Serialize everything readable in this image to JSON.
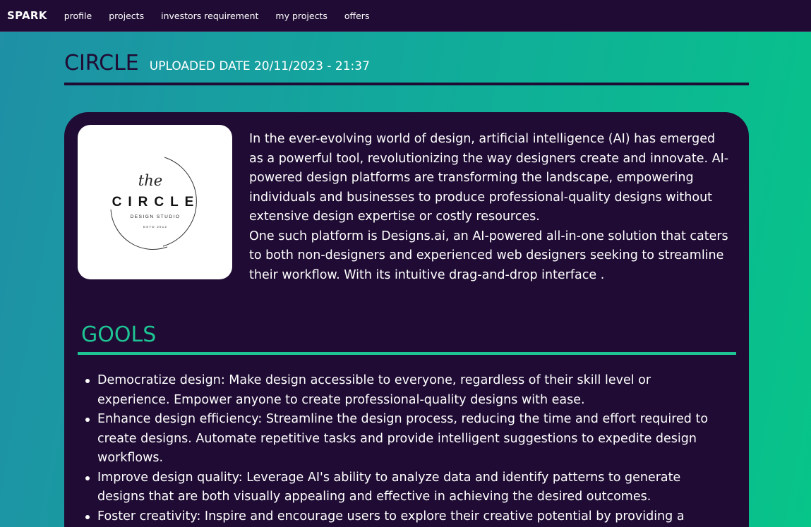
{
  "nav": {
    "brand": "SPARK",
    "links": [
      "profile",
      "projects",
      "investors requirement",
      "my projects",
      "offers"
    ]
  },
  "project": {
    "name": "CIRCLE",
    "uploaded": "UPLOADED DATE 20/11/2023 - 21:37"
  },
  "logo": {
    "script": "the",
    "name": "CIRCLE",
    "subtitle": "DESIGN STUDIO",
    "established": "ESTD 2012"
  },
  "description": {
    "paragraph1": "In the ever-evolving world of design, artificial intelligence (AI) has emerged as a powerful tool, revolutionizing the way designers create and innovate. AI-powered design platforms are transforming the landscape, empowering individuals and businesses to produce professional-quality designs without extensive design expertise or costly resources.",
    "paragraph2": "One such platform is Designs.ai, an AI-powered all-in-one solution that caters to both non-designers and experienced web designers seeking to streamline their workflow. With its intuitive drag-and-drop interface ."
  },
  "goals": {
    "heading": "GOOLS",
    "items": [
      "Democratize design: Make design accessible to everyone, regardless of their skill level or experience. Empower anyone to create professional-quality designs with ease.",
      "Enhance design efficiency: Streamline the design process, reducing the time and effort required to create designs. Automate repetitive tasks and provide intelligent suggestions to expedite design workflows.",
      "Improve design quality: Leverage AI's ability to analyze data and identify patterns to generate designs that  are both visually appealing and effective in achieving the desired outcomes.",
      "Foster creativity: Inspire and encourage users to explore their creative potential by providing a platform that allows them to experiment with different design elements and styles."
    ]
  },
  "colors": {
    "dark": "#1f0b33",
    "accent": "#1ec493"
  }
}
